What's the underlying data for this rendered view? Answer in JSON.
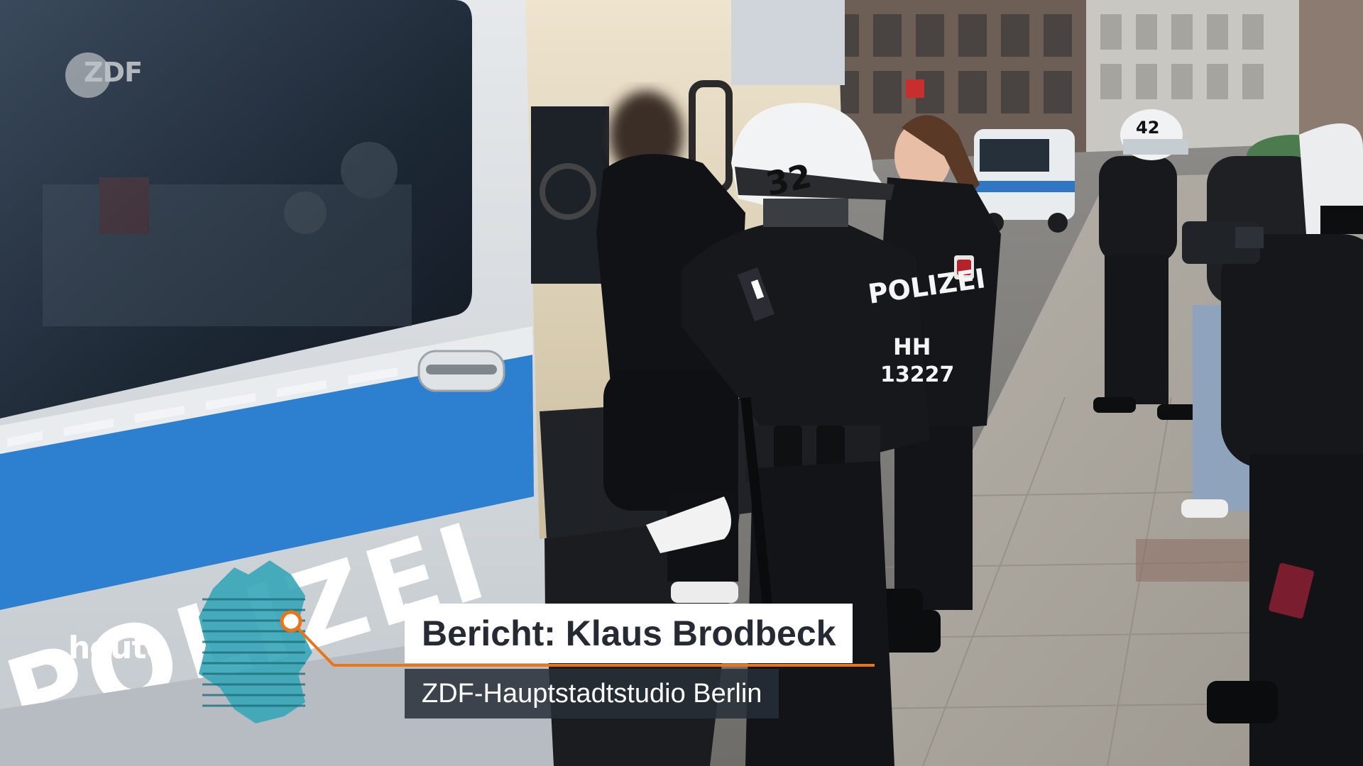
{
  "broadcast": {
    "channel_logo": "ZDF",
    "program": "heute",
    "lower_third": {
      "name_line": "Bericht: Klaus Brodbeck",
      "role_line": "ZDF-Hauptstadtstudio Berlin"
    }
  },
  "scene_text": {
    "van_lettering": "POLIZEI",
    "jacket_lettering": "POLIZEI",
    "jacket_id": "HH",
    "jacket_number": "13227",
    "helmet_number": "32",
    "helmet_number_back": "42"
  },
  "colors": {
    "accent_orange": "#e8751a",
    "map_teal": "#3aa7b8",
    "van_blue": "#2d7fd0",
    "van_silver": "#d5dade",
    "uniform_black": "#16181c",
    "pavement": "#a8a49d"
  },
  "icons": {
    "germany_map": "germany-map-icon",
    "orange_pin": "location-pin-icon"
  }
}
